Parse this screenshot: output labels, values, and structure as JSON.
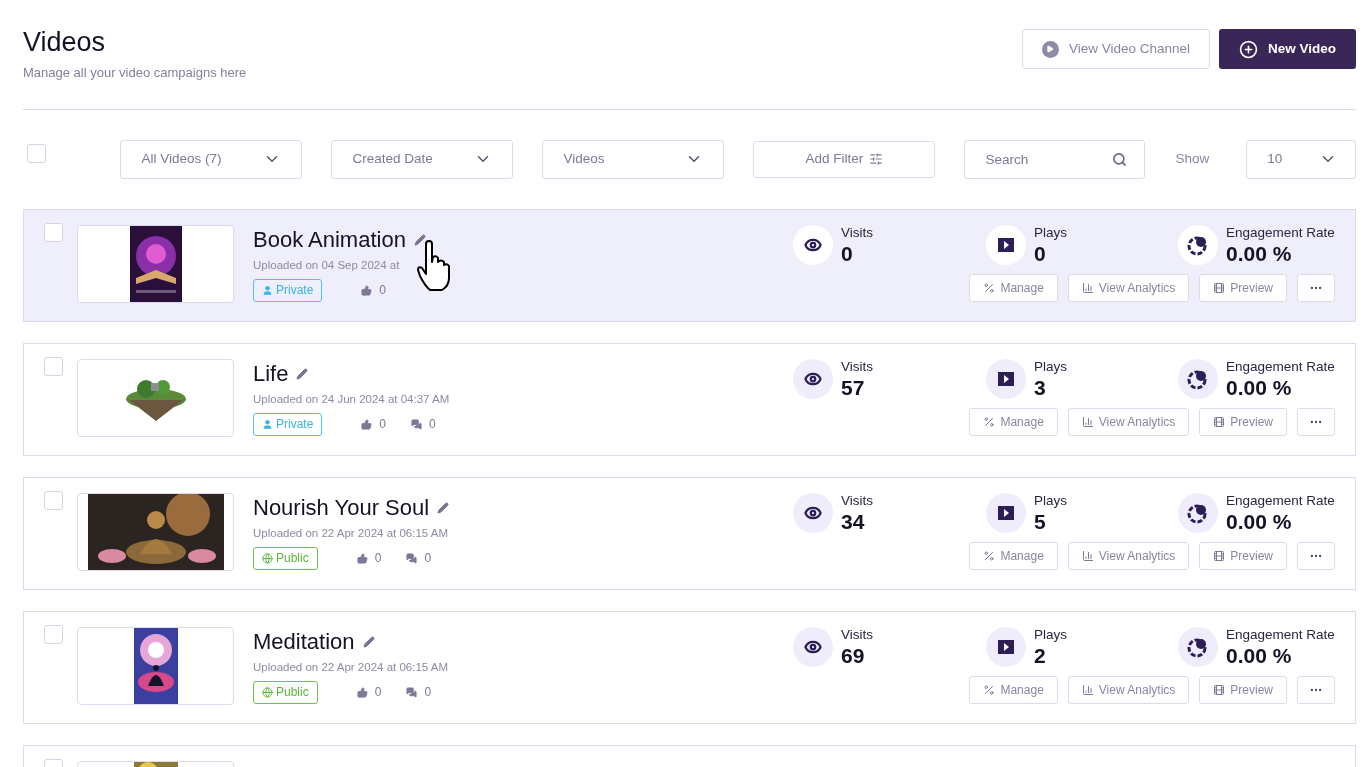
{
  "header": {
    "title": "Videos",
    "subtitle": "Manage all your video campaigns here",
    "buttons": [
      {
        "kind": "secondary",
        "label": "View Video Channel"
      },
      {
        "kind": "primary",
        "label": "New Video"
      }
    ]
  },
  "toolbar": {
    "select_all": {
      "checked": false
    },
    "filters": [
      {
        "kind": "dropdown",
        "label": "All Videos (7)"
      },
      {
        "kind": "dropdown",
        "label": "Created Date"
      },
      {
        "kind": "dropdown",
        "label": "Videos"
      },
      {
        "kind": "button",
        "label": "Add Filter"
      },
      {
        "kind": "search",
        "placeholder": "Search"
      }
    ],
    "show": {
      "label": "Show",
      "value": "10"
    }
  },
  "videos": [
    {
      "checked": false,
      "selected": true,
      "title": "Book Animation",
      "uploaded": "Uploaded on 04 Sep 2024 at",
      "visibility": {
        "kind": "private",
        "label": "Private"
      },
      "likes": "0",
      "stats": [
        {
          "kind": "visits",
          "label": "Visits",
          "value": "0"
        },
        {
          "kind": "plays",
          "label": "Plays",
          "value": "0"
        },
        {
          "kind": "engagement",
          "label": "Engagement Rate",
          "value": "0.00 %"
        }
      ],
      "actions": [
        {
          "kind": "manage",
          "label": "Manage"
        },
        {
          "kind": "analytics",
          "label": "View Analytics"
        },
        {
          "kind": "preview",
          "label": "Preview"
        },
        {
          "kind": "more"
        }
      ]
    },
    {
      "checked": false,
      "selected": false,
      "title": "Life",
      "uploaded": "Uploaded on 24 Jun 2024 at 04:37 AM",
      "visibility": {
        "kind": "private",
        "label": "Private"
      },
      "likes": "0",
      "comments": "0",
      "stats": [
        {
          "kind": "visits",
          "label": "Visits",
          "value": "57"
        },
        {
          "kind": "plays",
          "label": "Plays",
          "value": "3"
        },
        {
          "kind": "engagement",
          "label": "Engagement Rate",
          "value": "0.00 %"
        }
      ],
      "actions": [
        {
          "kind": "manage",
          "label": "Manage"
        },
        {
          "kind": "analytics",
          "label": "View Analytics"
        },
        {
          "kind": "preview",
          "label": "Preview"
        },
        {
          "kind": "more"
        }
      ]
    },
    {
      "checked": false,
      "selected": false,
      "title": "Nourish Your Soul",
      "uploaded": "Uploaded on 22 Apr 2024 at 06:15 AM",
      "visibility": {
        "kind": "public",
        "label": "Public"
      },
      "likes": "0",
      "comments": "0",
      "stats": [
        {
          "kind": "visits",
          "label": "Visits",
          "value": "34"
        },
        {
          "kind": "plays",
          "label": "Plays",
          "value": "5"
        },
        {
          "kind": "engagement",
          "label": "Engagement Rate",
          "value": "0.00 %"
        }
      ],
      "actions": [
        {
          "kind": "manage",
          "label": "Manage"
        },
        {
          "kind": "analytics",
          "label": "View Analytics"
        },
        {
          "kind": "preview",
          "label": "Preview"
        },
        {
          "kind": "more"
        }
      ]
    },
    {
      "checked": false,
      "selected": false,
      "title": "Meditation",
      "uploaded": "Uploaded on 22 Apr 2024 at 06:15 AM",
      "visibility": {
        "kind": "public",
        "label": "Public"
      },
      "likes": "0",
      "comments": "0",
      "stats": [
        {
          "kind": "visits",
          "label": "Visits",
          "value": "69"
        },
        {
          "kind": "plays",
          "label": "Plays",
          "value": "2"
        },
        {
          "kind": "engagement",
          "label": "Engagement Rate",
          "value": "0.00 %"
        }
      ],
      "actions": [
        {
          "kind": "manage",
          "label": "Manage"
        },
        {
          "kind": "analytics",
          "label": "View Analytics"
        },
        {
          "kind": "preview",
          "label": "Preview"
        },
        {
          "kind": "more"
        }
      ]
    },
    {
      "checked": false,
      "selected": false
    }
  ]
}
